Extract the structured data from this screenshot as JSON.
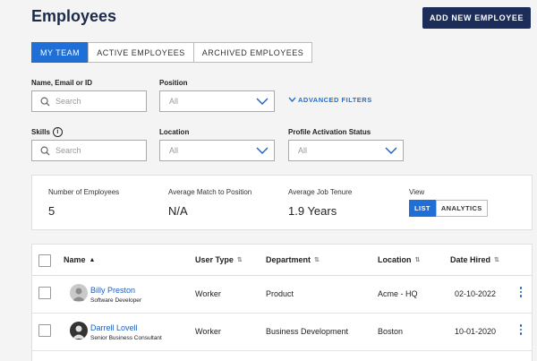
{
  "header": {
    "title": "Employees",
    "add_button": "ADD NEW EMPLOYEE"
  },
  "tabs": [
    {
      "label": "MY TEAM",
      "active": true
    },
    {
      "label": "ACTIVE EMPLOYEES",
      "active": false
    },
    {
      "label": "ARCHIVED EMPLOYEES",
      "active": false
    }
  ],
  "filters": {
    "name_label": "Name, Email or ID",
    "name_placeholder": "Search",
    "position_label": "Position",
    "position_value": "All",
    "advanced_filters": "ADVANCED FILTERS",
    "skills_label": "Skills",
    "skills_placeholder": "Search",
    "location_label": "Location",
    "location_value": "All",
    "profile_status_label": "Profile Activation Status",
    "profile_status_value": "All"
  },
  "stats": {
    "num_employees_label": "Number of Employees",
    "num_employees_value": "5",
    "avg_match_label": "Average Match to Position",
    "avg_match_value": "N/A",
    "avg_tenure_label": "Average Job Tenure",
    "avg_tenure_value": "1.9 Years",
    "view_label": "View",
    "view_list": "LIST",
    "view_analytics": "ANALYTICS"
  },
  "table": {
    "columns": [
      "Name",
      "User Type",
      "Department",
      "Location",
      "Date Hired"
    ],
    "rows": [
      {
        "name": "Billy Preston",
        "title": "Software Developer",
        "user_type": "Worker",
        "department": "Product",
        "location": "Acme - HQ",
        "date_hired": "02-10-2022"
      },
      {
        "name": "Darrell Lovell",
        "title": "Senior Business Consultant",
        "user_type": "Worker",
        "department": "Business Development",
        "location": "Boston",
        "date_hired": "10-01-2020"
      }
    ]
  },
  "colors": {
    "primary": "#1f6fd6",
    "navy": "#1c2d5a",
    "link": "#1f5fbf"
  }
}
